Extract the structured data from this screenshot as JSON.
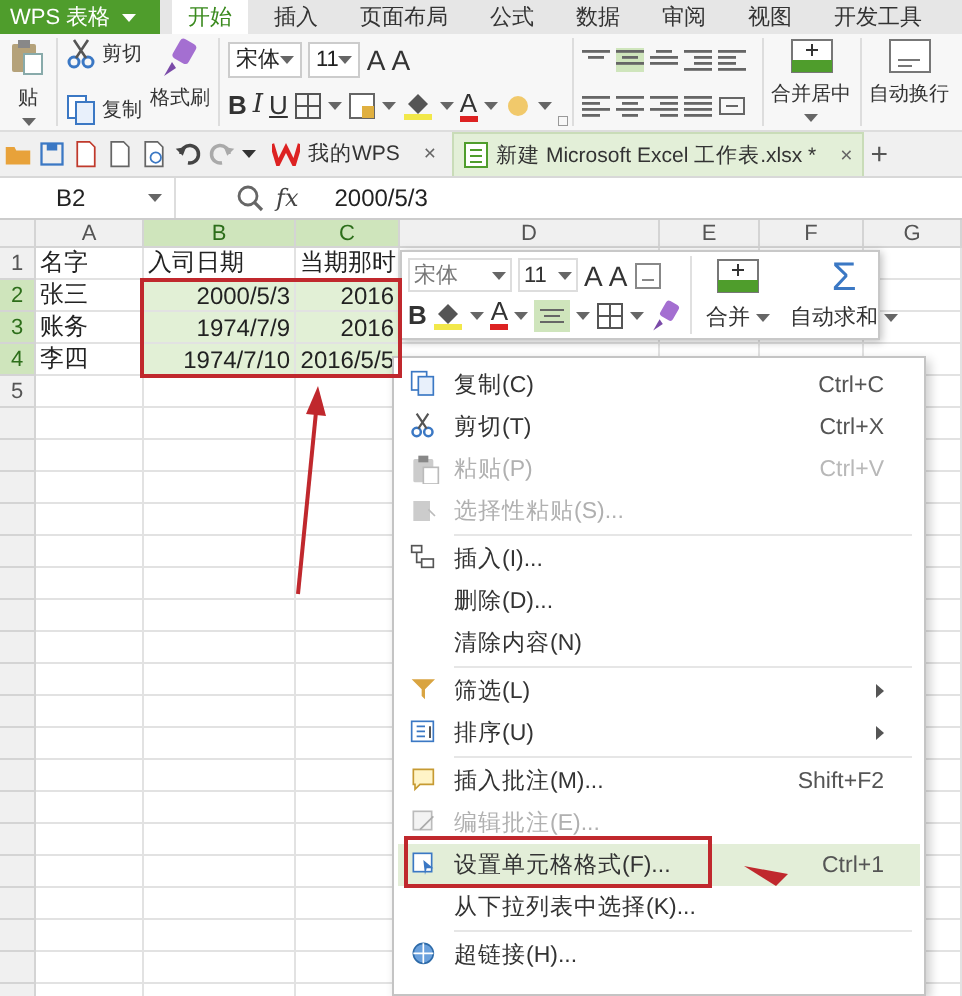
{
  "app_title": "WPS 表格",
  "ribbon_tabs": [
    {
      "label": "开始",
      "selected": true
    },
    {
      "label": "插入",
      "selected": false
    },
    {
      "label": "页面布局",
      "selected": false
    },
    {
      "label": "公式",
      "selected": false
    },
    {
      "label": "数据",
      "selected": false
    },
    {
      "label": "审阅",
      "selected": false
    },
    {
      "label": "视图",
      "selected": false
    },
    {
      "label": "开发工具",
      "selected": false
    }
  ],
  "ribbon": {
    "paste": "贴",
    "cut": "剪切",
    "copy": "复制",
    "format_painter": "格式刷",
    "font_name": "宋体",
    "font_size": "11",
    "grow_font": "A",
    "shrink_font": "A",
    "bold": "B",
    "italic": "I",
    "underline": "U",
    "font_color": "A",
    "merge_center": "合并居中",
    "wrap_text": "自动换行"
  },
  "doc_tabs": [
    {
      "label": "我的WPS",
      "close": "×",
      "selected": false
    },
    {
      "label": "新建 Microsoft Excel 工作表.xlsx *",
      "close": "×",
      "selected": true
    }
  ],
  "new_tab": "+",
  "formula_bar": {
    "cell_ref": "B2",
    "fx": "fx",
    "value": "2000/5/3"
  },
  "sheet": {
    "columns": [
      {
        "label": "A",
        "selected": false
      },
      {
        "label": "B",
        "selected": true
      },
      {
        "label": "C",
        "selected": true
      },
      {
        "label": "D",
        "selected": false
      },
      {
        "label": "E",
        "selected": false
      },
      {
        "label": "F",
        "selected": false
      },
      {
        "label": "G",
        "selected": false
      }
    ],
    "rows": [
      {
        "number": "1",
        "selected": false,
        "cells": [
          {
            "text": "名字",
            "kind": "text"
          },
          {
            "text": "入司日期",
            "kind": "text"
          },
          {
            "text": "当期那时",
            "kind": "text"
          }
        ]
      },
      {
        "number": "2",
        "selected": true,
        "cells": [
          {
            "text": "张三",
            "kind": "text"
          },
          {
            "text": "2000/5/3",
            "kind": "number"
          },
          {
            "text": "2016",
            "kind": "number"
          }
        ]
      },
      {
        "number": "3",
        "selected": true,
        "cells": [
          {
            "text": "账务",
            "kind": "text"
          },
          {
            "text": "1974/7/9",
            "kind": "number"
          },
          {
            "text": "2016",
            "kind": "number"
          }
        ]
      },
      {
        "number": "4",
        "selected": true,
        "cells": [
          {
            "text": "李四",
            "kind": "text"
          },
          {
            "text": "1974/7/10",
            "kind": "number"
          },
          {
            "text": "2016/5/5",
            "kind": "number"
          }
        ]
      },
      {
        "number": "5",
        "selected": false
      }
    ]
  },
  "mini_toolbar": {
    "font_name": "宋体",
    "font_size": "11",
    "grow_font": "A",
    "shrink_font": "A",
    "bold": "B",
    "font_color": "A",
    "merge": "合并",
    "autosum_symbol": "Σ",
    "autosum": "自动求和"
  },
  "context_menu": {
    "items": [
      {
        "kind": "item",
        "label": "复制(C)",
        "shortcut": "Ctrl+C",
        "disabled": false,
        "selected": false,
        "submenu": false
      },
      {
        "kind": "item",
        "label": "剪切(T)",
        "shortcut": "Ctrl+X",
        "disabled": false,
        "selected": false,
        "submenu": false
      },
      {
        "kind": "item",
        "label": "粘贴(P)",
        "shortcut": "Ctrl+V",
        "disabled": true,
        "selected": false,
        "submenu": false
      },
      {
        "kind": "item",
        "label": "选择性粘贴(S)...",
        "disabled": true,
        "selected": false,
        "submenu": false
      },
      {
        "kind": "separator"
      },
      {
        "kind": "item",
        "label": "插入(I)...",
        "disabled": false,
        "selected": false,
        "submenu": false
      },
      {
        "kind": "item",
        "label": "删除(D)...",
        "disabled": false,
        "selected": false,
        "submenu": false
      },
      {
        "kind": "item",
        "label": "清除内容(N)",
        "disabled": false,
        "selected": false,
        "submenu": false
      },
      {
        "kind": "separator"
      },
      {
        "kind": "item",
        "label": "筛选(L)",
        "disabled": false,
        "selected": false,
        "submenu": true
      },
      {
        "kind": "item",
        "label": "排序(U)",
        "disabled": false,
        "selected": false,
        "submenu": true
      },
      {
        "kind": "separator"
      },
      {
        "kind": "item",
        "label": "插入批注(M)...",
        "shortcut": "Shift+F2",
        "disabled": false,
        "selected": false,
        "submenu": false
      },
      {
        "kind": "item",
        "label": "编辑批注(E)...",
        "disabled": true,
        "selected": false,
        "submenu": false
      },
      {
        "kind": "item",
        "label": "设置单元格格式(F)...",
        "shortcut": "Ctrl+1",
        "disabled": false,
        "selected": true,
        "submenu": false
      },
      {
        "kind": "item",
        "label": "从下拉列表中选择(K)...",
        "disabled": false,
        "selected": false,
        "submenu": false
      },
      {
        "kind": "separator"
      },
      {
        "kind": "item",
        "label": "超链接(H)...",
        "disabled": false,
        "selected": false,
        "submenu": false
      }
    ]
  }
}
